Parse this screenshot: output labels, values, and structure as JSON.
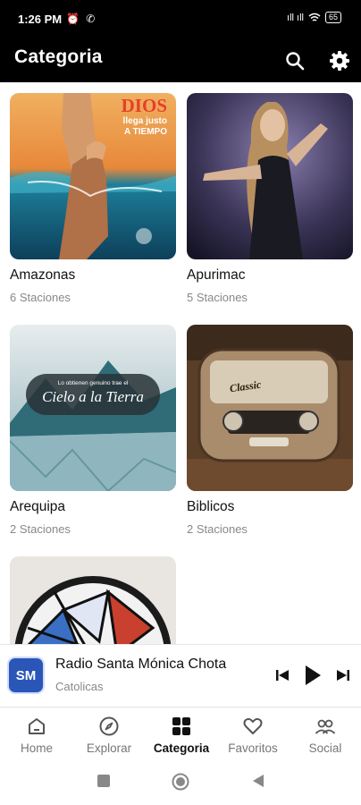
{
  "status": {
    "time": "1:26 PM",
    "extras": "⏰ ✆",
    "signal": "ıll ıll",
    "battery": "65"
  },
  "header": {
    "title": "Categoria",
    "search_icon": "search-icon",
    "settings_icon": "gear-icon",
    "color": "#000000"
  },
  "categories": [
    {
      "title": "Amazonas",
      "subtitle": "6 Staciones",
      "image_text_1": "DIOS",
      "image_text_2": "llega justo\nA TIEMPO"
    },
    {
      "title": "Apurimac",
      "subtitle": "5 Staciones"
    },
    {
      "title": "Arequipa",
      "subtitle": "2 Staciones",
      "image_text_1": "Lo obtienen genuino trae el",
      "image_text_2": "Cielo a la Tierra"
    },
    {
      "title": "Biblicos",
      "subtitle": "2 Staciones",
      "image_text_1": "Classic"
    },
    {
      "title": "",
      "subtitle": ""
    }
  ],
  "player": {
    "logo": "SM",
    "title": "Radio Santa Mónica Chota",
    "subtitle": "Catolicas",
    "accent": "#2a56b8"
  },
  "nav": [
    {
      "label": "Home",
      "icon": "home-icon"
    },
    {
      "label": "Explorar",
      "icon": "compass-icon"
    },
    {
      "label": "Categoria",
      "icon": "grid-icon"
    },
    {
      "label": "Favoritos",
      "icon": "heart-icon"
    },
    {
      "label": "Social",
      "icon": "people-icon"
    }
  ],
  "active_nav": "Categoria"
}
